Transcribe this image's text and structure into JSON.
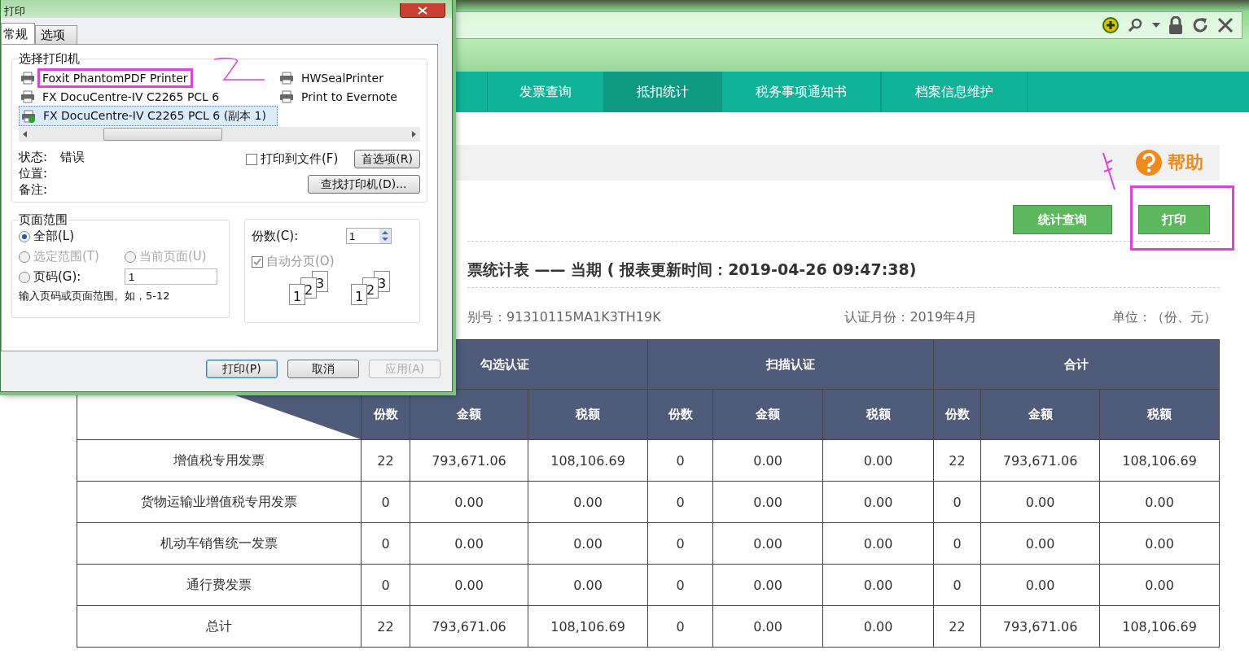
{
  "nav": {
    "tabs": [
      {
        "label": "发票查询",
        "selected": false
      },
      {
        "label": "抵扣统计",
        "selected": true
      },
      {
        "label": "税务事项通知书",
        "selected": false
      },
      {
        "label": "档案信息维护",
        "selected": false
      }
    ]
  },
  "help": {
    "label": "帮助"
  },
  "actions": [
    "统计查询",
    "打印"
  ],
  "report": {
    "title": "票统计表 —— 当期 ( 报表更新时间：2019-04-26 09:47:38)",
    "taxpayer_id": "别号：91310115MA1K3TH19K",
    "month": "认证月份：2019年4月",
    "unit": "单位：（份、元）"
  },
  "table": {
    "groups": [
      "勾选认证",
      "扫描认证",
      "合计"
    ],
    "columns": [
      "份数",
      "金额",
      "税额",
      "份数",
      "金额",
      "税额",
      "份数",
      "金额",
      "税额"
    ],
    "rows": [
      {
        "type": "增值税专用发票",
        "cells": [
          "22",
          "793,671.06",
          "108,106.69",
          "0",
          "0.00",
          "0.00",
          "22",
          "793,671.06",
          "108,106.69"
        ]
      },
      {
        "type": "货物运输业增值税专用发票",
        "cells": [
          "0",
          "0.00",
          "0.00",
          "0",
          "0.00",
          "0.00",
          "0",
          "0.00",
          "0.00"
        ]
      },
      {
        "type": "机动车销售统一发票",
        "cells": [
          "0",
          "0.00",
          "0.00",
          "0",
          "0.00",
          "0.00",
          "0",
          "0.00",
          "0.00"
        ]
      },
      {
        "type": "通行费发票",
        "cells": [
          "0",
          "0.00",
          "0.00",
          "0",
          "0.00",
          "0.00",
          "0",
          "0.00",
          "0.00"
        ]
      },
      {
        "type": "总计",
        "cells": [
          "22",
          "793,671.06",
          "108,106.69",
          "0",
          "0.00",
          "0.00",
          "22",
          "793,671.06",
          "108,106.69"
        ]
      }
    ]
  },
  "dialog": {
    "title": "打印",
    "tabs": [
      {
        "label": "常规",
        "selected": true
      },
      {
        "label": "选项",
        "selected": false
      }
    ],
    "printer_section": "选择打印机",
    "printers": [
      {
        "name": "Foxit PhantomPDF Printer",
        "selected": false,
        "default": false,
        "highlighted": true
      },
      {
        "name": "FX DocuCentre-IV C2265 PCL 6",
        "selected": false,
        "default": false,
        "highlighted": false
      },
      {
        "name": "FX DocuCentre-IV C2265 PCL 6 (副本 1)",
        "selected": true,
        "default": true,
        "highlighted": false
      },
      {
        "name": "HWSealPrinter",
        "selected": false,
        "default": false,
        "highlighted": false
      },
      {
        "name": "Print to Evernote",
        "selected": false,
        "default": false,
        "highlighted": false
      }
    ],
    "status": [
      {
        "label": "状态:",
        "value": "错误"
      },
      {
        "label": "位置:"
      },
      {
        "label": "备注:"
      }
    ],
    "print_to_file": {
      "label": "打印到文件(F)",
      "checked": false
    },
    "preferences": "首选项(R)",
    "find_printer": "查找打印机(D)...",
    "page_range": {
      "legend": "页面范围",
      "options": [
        {
          "label": "全部(L)",
          "selected": true,
          "disabled": false
        },
        {
          "label": "选定范围(T)",
          "selected": false,
          "disabled": true
        },
        {
          "label": "当前页面(U)",
          "selected": false,
          "disabled": true
        },
        {
          "label": "页码(G):",
          "selected": false,
          "disabled": false
        }
      ],
      "pages_value": "1",
      "hint": "输入页码或页面范围。如，5-12"
    },
    "copies": {
      "label": "份数(C):",
      "value": "1",
      "collate": {
        "label": "自动分页(O)",
        "checked": true,
        "disabled": true
      },
      "collate_stacks": [
        [
          "1",
          "2",
          "3"
        ],
        [
          "1",
          "2",
          "3"
        ]
      ]
    },
    "buttons": [
      {
        "label": "打印(P)",
        "default": true,
        "disabled": false
      },
      {
        "label": "取消",
        "default": false,
        "disabled": false
      },
      {
        "label": "应用(A)",
        "default": false,
        "disabled": true
      }
    ]
  },
  "annotations": {
    "print_button_highlighted": true
  }
}
